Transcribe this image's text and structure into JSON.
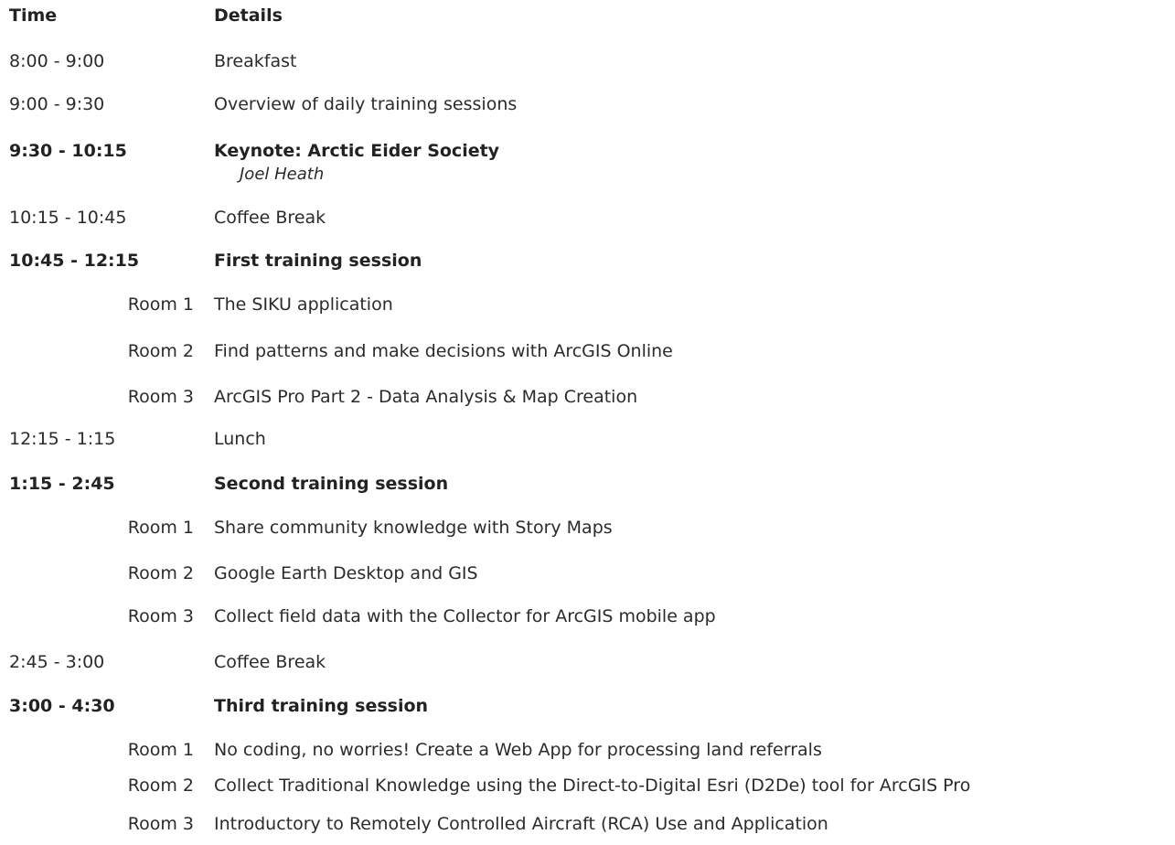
{
  "header": {
    "time": "Time",
    "details": "Details"
  },
  "rows": [
    {
      "time": "8:00 - 9:00",
      "detail": "Breakfast"
    },
    {
      "time": "9:00 - 9:30",
      "detail": "Overview of daily training sessions"
    },
    {
      "time": "9:30 - 10:15",
      "detail": "Keynote: Arctic Eider Society",
      "speaker": "Joel Heath"
    },
    {
      "time": "10:15 - 10:45",
      "detail": "Coffee Break"
    },
    {
      "time": "10:45 - 12:15",
      "detail": "First training session"
    },
    {
      "room": "Room 1",
      "detail": "The SIKU application"
    },
    {
      "room": "Room 2",
      "detail": "Find patterns and make decisions with ArcGIS Online"
    },
    {
      "room": "Room 3",
      "detail": "ArcGIS Pro Part 2 - Data Analysis & Map Creation"
    },
    {
      "time": "12:15 - 1:15",
      "detail": "Lunch"
    },
    {
      "time": "1:15 - 2:45",
      "detail": "Second training session"
    },
    {
      "room": "Room 1",
      "detail": "Share community knowledge with Story Maps"
    },
    {
      "room": "Room 2",
      "detail": "Google Earth Desktop and GIS"
    },
    {
      "room": "Room 3",
      "detail": "Collect field data with the Collector for ArcGIS mobile app"
    },
    {
      "time": "2:45 - 3:00",
      "detail": "Coffee Break"
    },
    {
      "time": "3:00 - 4:30",
      "detail": "Third training session"
    },
    {
      "room": "Room 1",
      "detail": "No coding, no worries! Create a Web App for processing land referrals"
    },
    {
      "room": "Room 2",
      "detail": "Collect Traditional Knowledge using the Direct-to-Digital Esri (D2De) tool for ArcGIS Pro"
    },
    {
      "room": "Room 3",
      "detail": "Introductory to Remotely Controlled Aircraft (RCA) Use and Application"
    }
  ]
}
